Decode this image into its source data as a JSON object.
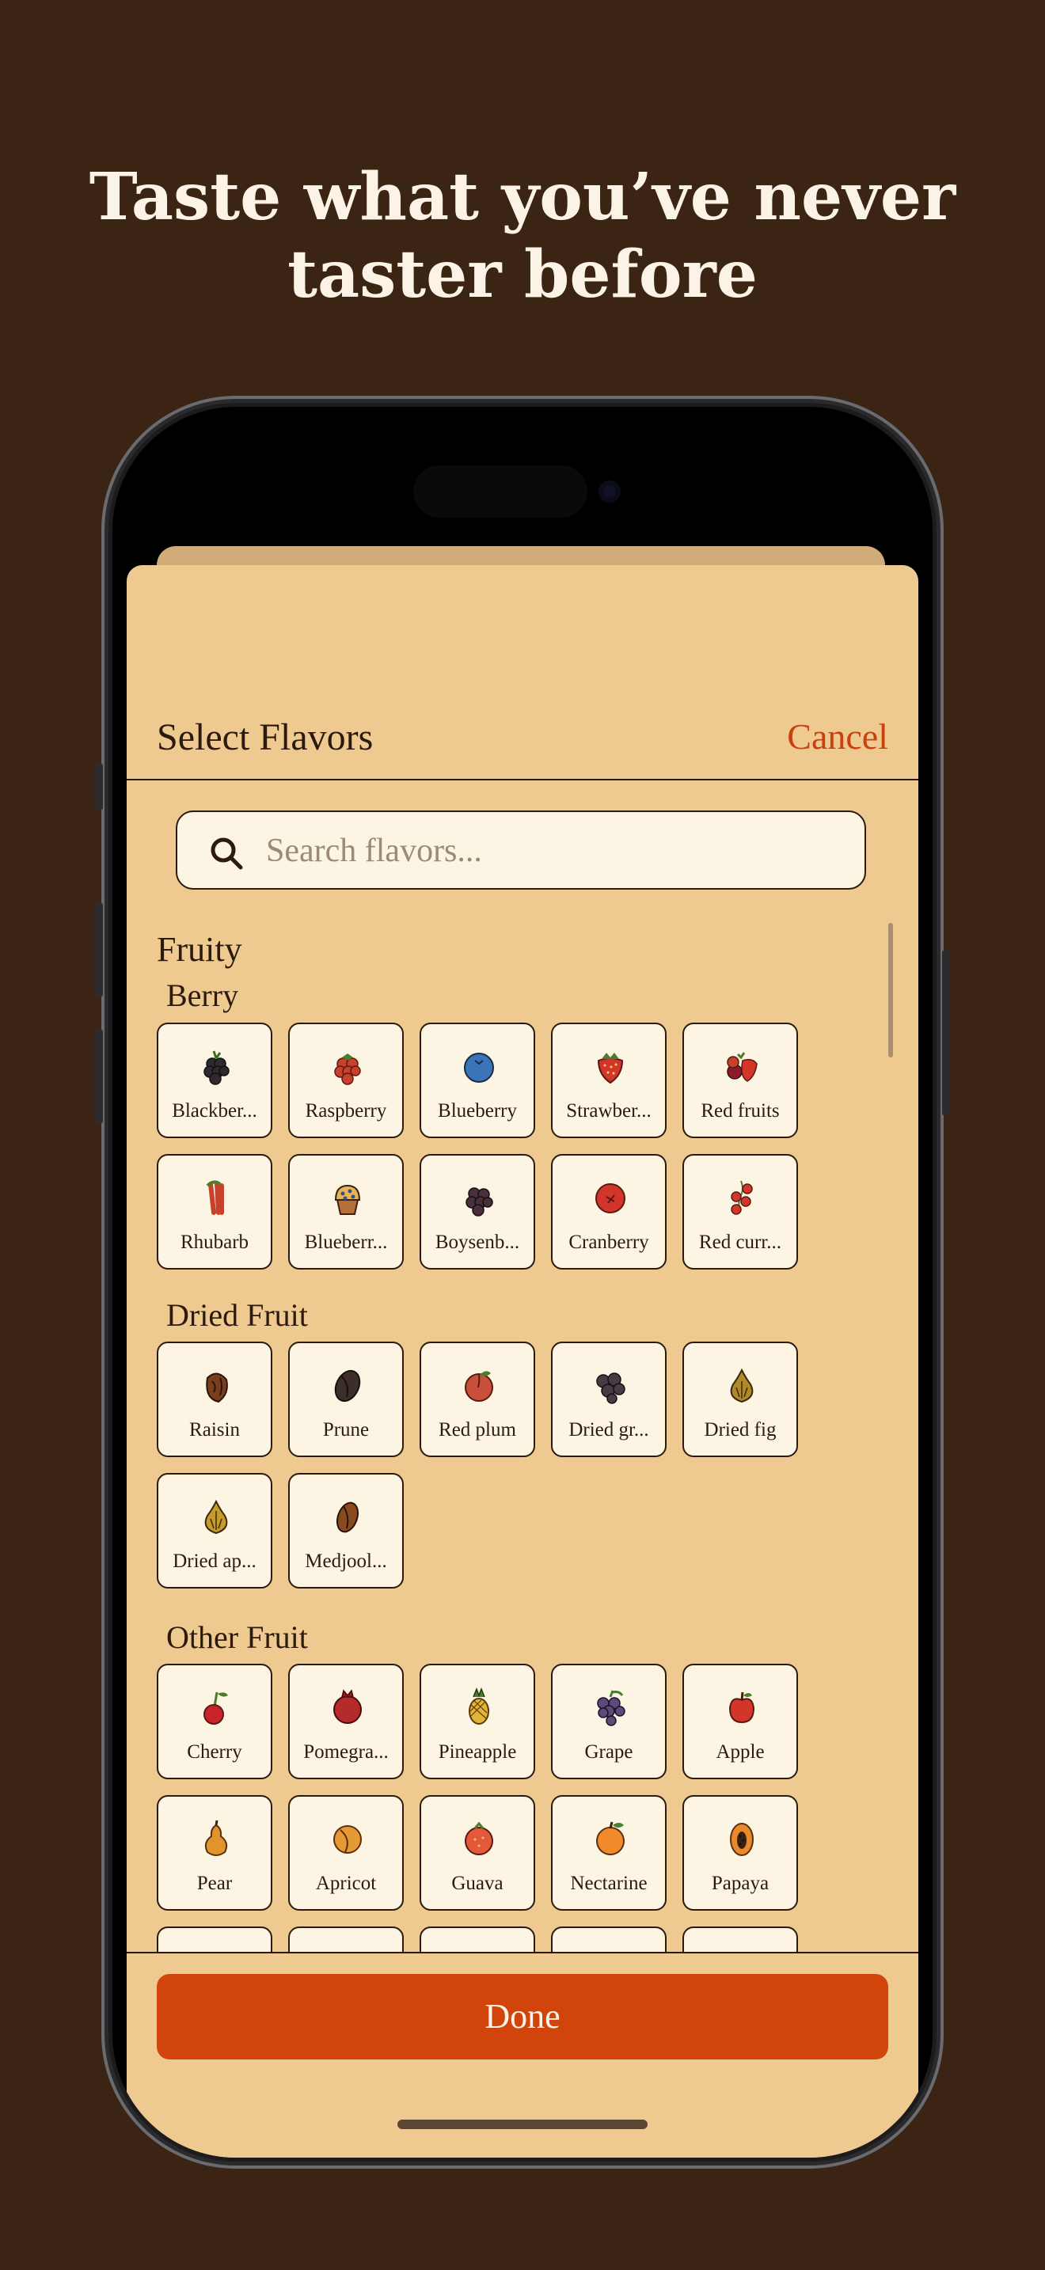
{
  "headline": {
    "line1": "Taste what you’ve never",
    "line2": "taster before"
  },
  "sheet": {
    "title": "Select Flavors",
    "cancel_label": "Cancel",
    "done_label": "Done"
  },
  "search": {
    "placeholder": "Search flavors..."
  },
  "groups": [
    {
      "title": "Fruity",
      "sections": [
        {
          "title": "Berry",
          "items": [
            {
              "label": "Blackber...",
              "icon": "blackberry"
            },
            {
              "label": "Raspberry",
              "icon": "raspberry"
            },
            {
              "label": "Blueberry",
              "icon": "blueberry"
            },
            {
              "label": "Strawber...",
              "icon": "strawberry"
            },
            {
              "label": "Red fruits",
              "icon": "red-fruits"
            },
            {
              "label": "Rhubarb",
              "icon": "rhubarb"
            },
            {
              "label": "Blueberr...",
              "icon": "muffin"
            },
            {
              "label": "Boysenb...",
              "icon": "boysenberry"
            },
            {
              "label": "Cranberry",
              "icon": "cranberry"
            },
            {
              "label": "Red curr...",
              "icon": "red-currant"
            }
          ]
        },
        {
          "title": "Dried Fruit",
          "items": [
            {
              "label": "Raisin",
              "icon": "raisin"
            },
            {
              "label": "Prune",
              "icon": "prune"
            },
            {
              "label": "Red plum",
              "icon": "red-plum"
            },
            {
              "label": "Dried gr...",
              "icon": "dried-grape"
            },
            {
              "label": "Dried fig",
              "icon": "fig"
            },
            {
              "label": "Dried ap...",
              "icon": "dried-apricot"
            },
            {
              "label": "Medjool...",
              "icon": "date"
            }
          ]
        },
        {
          "title": "Other Fruit",
          "items": [
            {
              "label": "Cherry",
              "icon": "cherry"
            },
            {
              "label": "Pomegra...",
              "icon": "pomegranate"
            },
            {
              "label": "Pineapple",
              "icon": "pineapple"
            },
            {
              "label": "Grape",
              "icon": "grape"
            },
            {
              "label": "Apple",
              "icon": "apple"
            },
            {
              "label": "Pear",
              "icon": "pear"
            },
            {
              "label": "Apricot",
              "icon": "apricot"
            },
            {
              "label": "Guava",
              "icon": "guava"
            },
            {
              "label": "Nectarine",
              "icon": "nectarine"
            },
            {
              "label": "Papaya",
              "icon": "papaya"
            },
            {
              "label": "",
              "icon": ""
            },
            {
              "label": "",
              "icon": ""
            },
            {
              "label": "",
              "icon": ""
            },
            {
              "label": "",
              "icon": ""
            },
            {
              "label": "",
              "icon": ""
            }
          ]
        }
      ]
    }
  ],
  "colors": {
    "background": "#3b2413",
    "sheet": "#eec990",
    "tile": "#fdf5e3",
    "accent": "#d1440c",
    "text": "#2b1a0d"
  }
}
